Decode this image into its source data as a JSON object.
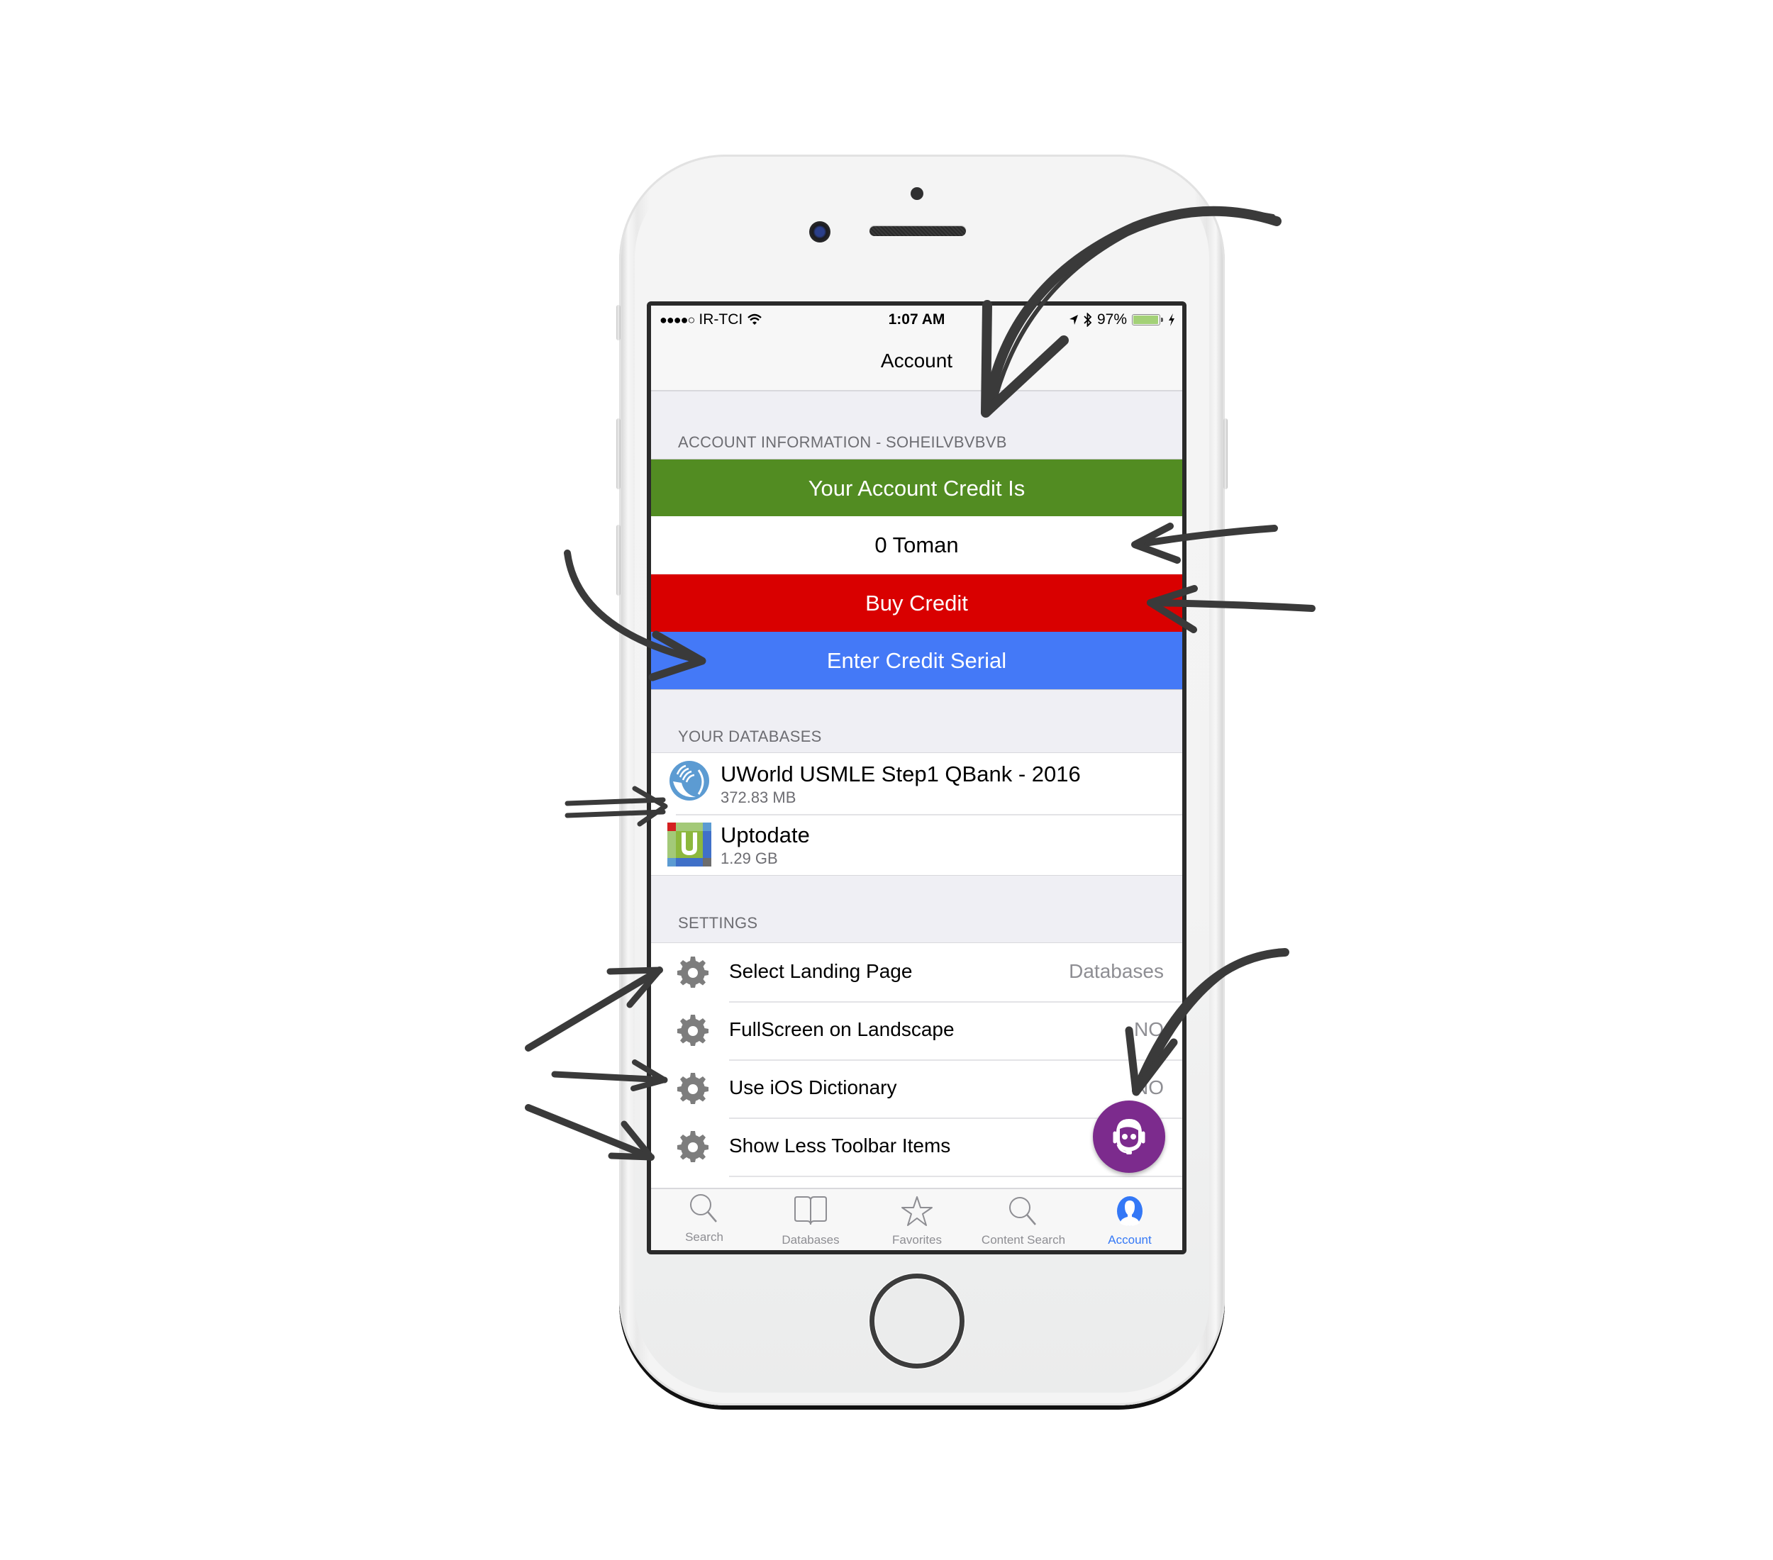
{
  "status_bar": {
    "signal": "●●●●○",
    "carrier": "IR-TCI",
    "time": "1:07 AM",
    "battery_percent": "97%",
    "battery_level": 0.97,
    "icons": [
      "wifi-icon",
      "location-arrow-icon",
      "bluetooth-icon",
      "battery-icon",
      "charging-bolt-icon"
    ]
  },
  "nav": {
    "title": "Account"
  },
  "account_section": {
    "header": "ACCOUNT INFORMATION - SOHEILVBVBVB",
    "credit_label": "Your Account Credit Is",
    "credit_value": "0 Toman",
    "buy_credit_label": "Buy Credit",
    "enter_serial_label": "Enter Credit Serial",
    "colors": {
      "credit_label_bg": "#528c22",
      "buy_credit_bg": "#d90000",
      "enter_serial_bg": "#4479f7"
    }
  },
  "databases_section": {
    "header": "YOUR DATABASES",
    "items": [
      {
        "title": "UWorld USMLE Step1 QBank - 2016",
        "size": "372.83 MB",
        "icon": "uworld-logo-icon"
      },
      {
        "title": "Uptodate",
        "size": "1.29 GB",
        "icon": "uptodate-logo-icon"
      }
    ]
  },
  "settings_section": {
    "header": "SETTINGS",
    "items": [
      {
        "label": "Select Landing Page",
        "value": "Databases",
        "icon": "gear-icon"
      },
      {
        "label": "FullScreen on Landscape",
        "value": "NO",
        "icon": "gear-icon"
      },
      {
        "label": "Use iOS Dictionary",
        "value": "NO",
        "icon": "gear-icon"
      },
      {
        "label": "Show Less Toolbar Items",
        "value": "",
        "icon": "gear-icon"
      },
      {
        "label": "",
        "value": "",
        "icon": "gear-icon"
      }
    ]
  },
  "support_button": {
    "icon": "support-agent-icon",
    "color": "#7c2b8d"
  },
  "tab_bar": {
    "active_color": "#3478f6",
    "tabs": [
      {
        "label": "Search",
        "icon": "search-icon",
        "active": false
      },
      {
        "label": "Databases",
        "icon": "book-icon",
        "active": false
      },
      {
        "label": "Favorites",
        "icon": "star-icon",
        "active": false
      },
      {
        "label": "Content Search",
        "icon": "search-icon",
        "active": false
      },
      {
        "label": "Account",
        "icon": "account-person-icon",
        "active": true
      }
    ]
  }
}
